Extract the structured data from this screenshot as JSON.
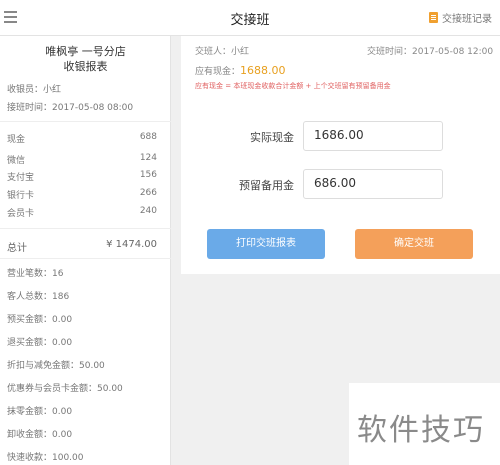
{
  "header": {
    "title": "交接班",
    "record_label": "交接班记录",
    "menu_icon": "menu-icon",
    "record_icon": "document-icon"
  },
  "receipt": {
    "store_name": "唯枫亭 一号分店",
    "report_title": "收银报表",
    "cashier": "收银员：小红",
    "time": "接班时间：2017-05-08  08:00",
    "payments": [
      {
        "label": "现金",
        "value": "688"
      },
      {
        "label": "微信",
        "value": "124"
      },
      {
        "label": "支付宝",
        "value": "156"
      },
      {
        "label": "银行卡",
        "value": "266"
      },
      {
        "label": "会员卡",
        "value": "240"
      }
    ],
    "total_label": "总计",
    "total_value": "¥ 1474.00",
    "stats": [
      "营业笔数：16",
      "客人总数：186",
      "预买金额：0.00",
      "退买金额：0.00",
      "折扣与减免金额：50.00",
      "优惠券与会员卡金额：50.00",
      "抹零金额：0.00",
      "卸收金额：0.00",
      "快速收款：100.00"
    ]
  },
  "handover": {
    "person": "交班人：小红",
    "time": "交班时间：2017-05-08   12:00",
    "cash_label": "应有现金：",
    "cash_value": "1688.00",
    "warning": "应有现金 = 本班现金收款合计金额 + 上个交班留有预留备用金",
    "actual_cash_label": "实际现金",
    "actual_cash_value": "1686.00",
    "reserve_label": "预留备用金",
    "reserve_value": "686.00",
    "print_button": "打印交班报表",
    "confirm_button": "确定交班"
  },
  "watermark": "软件技巧",
  "colors": {
    "accent_orange": "#f4a05a",
    "accent_blue": "#6aaae8",
    "amount": "#e8a020",
    "warning": "#e06060"
  }
}
